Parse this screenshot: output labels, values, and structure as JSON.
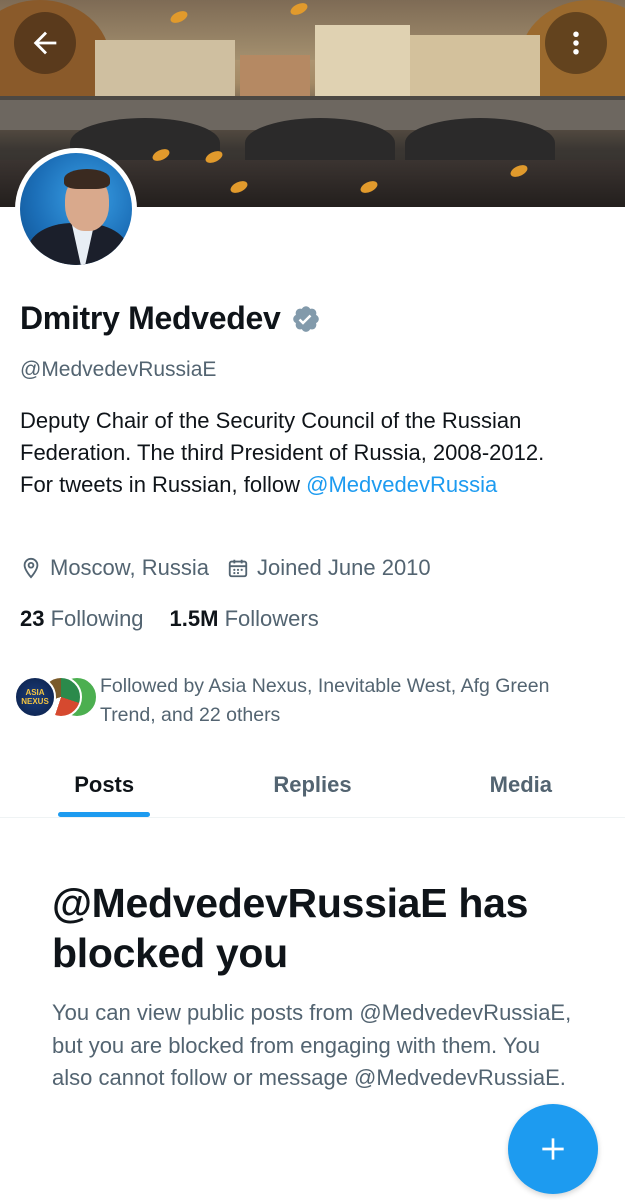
{
  "profile": {
    "name": "Dmitry Medvedev",
    "handle": "@MedvedevRussiaE",
    "bio_text": "Deputy Chair of the Security Council of the Russian Federation. The third President of Russia, 2008-2012. For tweets in Russian, follow ",
    "bio_link": "@MedvedevRussia",
    "location": "Moscow, Russia",
    "joined": "Joined June 2010",
    "following_count": "23",
    "following_label": "Following",
    "followers_count": "1.5M",
    "followers_label": "Followers",
    "followed_by": "Followed by Asia Nexus, Inevitable West, Afg Green Trend, and 22 others",
    "followed_by_avatar_text": "ASIA NEXUS"
  },
  "tabs": [
    {
      "label": "Posts",
      "active": true
    },
    {
      "label": "Replies",
      "active": false
    },
    {
      "label": "Media",
      "active": false
    }
  ],
  "blocked": {
    "title": "@MedvedevRussiaE has blocked you",
    "description": "You can view public posts from @MedvedevRussiaE, but you are blocked from engaging with them. You also cannot follow or message @MedvedevRussiaE."
  },
  "icons": {
    "back": "back-arrow-icon",
    "more": "more-vertical-icon",
    "verified": "verified-badge-icon",
    "location": "location-pin-icon",
    "calendar": "calendar-icon",
    "compose": "plus-icon"
  },
  "colors": {
    "accent": "#1d9bf0",
    "text_primary": "#0f1419",
    "text_secondary": "#536471",
    "verified_badge": "#829aab"
  }
}
